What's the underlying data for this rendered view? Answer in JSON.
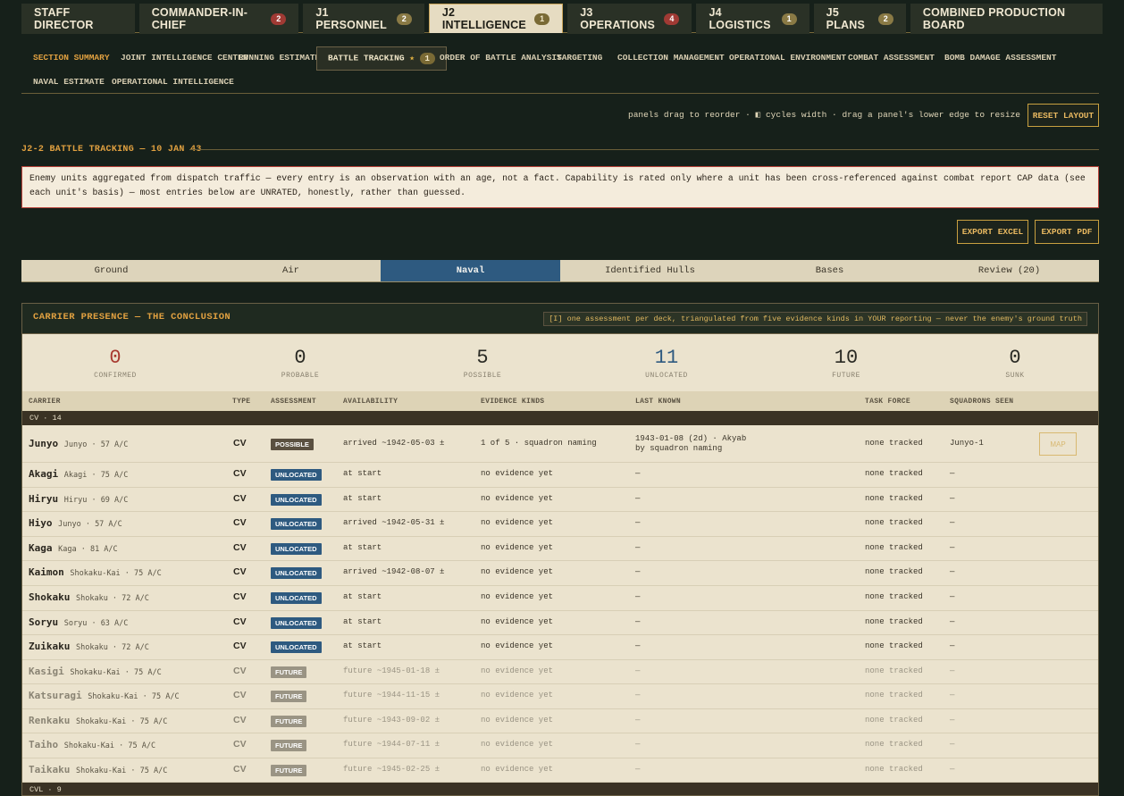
{
  "top_tabs": [
    {
      "label": "STAFF DIRECTOR",
      "badge": ""
    },
    {
      "label": "COMMANDER-IN-CHIEF",
      "badge": "2",
      "badge_style": "red"
    },
    {
      "label": "J1 PERSONNEL",
      "badge": "2",
      "badge_style": "olive"
    },
    {
      "label": "J2 INTELLIGENCE",
      "badge": "1",
      "badge_style": "gold",
      "active": true
    },
    {
      "label": "J3 OPERATIONS",
      "badge": "4",
      "badge_style": "red"
    },
    {
      "label": "J4 LOGISTICS",
      "badge": "1",
      "badge_style": "olive"
    },
    {
      "label": "J5 PLANS",
      "badge": "2",
      "badge_style": "olive"
    },
    {
      "label": "COMBINED PRODUCTION BOARD",
      "badge": ""
    }
  ],
  "sub_tabs": {
    "section_summary": "SECTION SUMMARY",
    "joint_intelligence_center": "JOINT INTELLIGENCE CENTER",
    "running_estimate": "RUNNING ESTIMATE",
    "battle_tracking": "BATTLE TRACKING",
    "battle_tracking_star": "★",
    "battle_tracking_badge": "1",
    "order_of_battle": "ORDER OF BATTLE ANALYSIS",
    "targeting": "TARGETING",
    "collection": "COLLECTION MANAGEMENT",
    "op_env": "OPERATIONAL ENVIRONMENT",
    "combat": "COMBAT ASSESSMENT",
    "bda": "BOMB DAMAGE ASSESSMENT",
    "naval_estimate": "NAVAL ESTIMATE",
    "op_intel": "OPERATIONAL INTELLIGENCE"
  },
  "layout_hint": "panels drag to reorder · ◧ cycles width · drag a panel's lower edge to resize",
  "reset_layout": "RESET LAYOUT",
  "section_title": "J2-2 BATTLE TRACKING — 10 JAN 43",
  "notice": "Enemy units aggregated from dispatch traffic — every entry is an observation with an age, not a fact. Capability is rated only where a unit has been cross-referenced against combat report CAP data (see each unit's basis) — most entries below are UNRATED, honestly, rather than guessed.",
  "export_excel": "EXPORT EXCEL",
  "export_pdf": "EXPORT PDF",
  "filter_tabs": {
    "ground": "Ground",
    "air": "Air",
    "naval": "Naval",
    "hulls": "Identified Hulls",
    "bases": "Bases",
    "review": "Review (20)"
  },
  "panel": {
    "title": "CARRIER PRESENCE — THE CONCLUSION",
    "note": "[I] one assessment per deck, triangulated from five evidence kinds in YOUR reporting — never the enemy's ground truth"
  },
  "stats": {
    "confirmed": {
      "value": "0",
      "label": "CONFIRMED",
      "color": "#a83a30"
    },
    "probable": {
      "value": "0",
      "label": "PROBABLE",
      "color": "#2a2a24"
    },
    "possible": {
      "value": "5",
      "label": "POSSIBLE",
      "color": "#2a2a24"
    },
    "unlocated": {
      "value": "11",
      "label": "UNLOCATED",
      "color": "#2e5a80"
    },
    "future": {
      "value": "10",
      "label": "FUTURE",
      "color": "#2a2a24"
    },
    "sunk": {
      "value": "0",
      "label": "SUNK",
      "color": "#2a2a24"
    }
  },
  "columns": {
    "carrier": "CARRIER",
    "type": "TYPE",
    "assessment": "ASSESSMENT",
    "availability": "AVAILABILITY",
    "evidence": "EVIDENCE KINDS",
    "last_known": "LAST KNOWN",
    "task_force": "TASK FORCE",
    "squadrons": "SQUADRONS SEEN"
  },
  "groups": {
    "cv": "CV · 14",
    "cvl": "CVL · 9"
  },
  "map_label": "MAP",
  "carriers": [
    {
      "name": "Junyo",
      "sub": "Junyo · 57 A/C",
      "type": "CV",
      "assessment": "POSSIBLE",
      "chip": "possible",
      "availability": "arrived ~1942-05-03 ±",
      "evidence": "1 of 5 · squadron naming",
      "last_known_1": "1943-01-08 (2d) · Akyab",
      "last_known_2": "by squadron naming",
      "task_force": "none tracked",
      "squadrons": "Junyo-1"
    },
    {
      "name": "Akagi",
      "sub": "Akagi · 75 A/C",
      "type": "CV",
      "assessment": "UNLOCATED",
      "chip": "unlocated",
      "availability": "at start",
      "evidence": "no evidence yet",
      "last_known_1": "—",
      "task_force": "none tracked",
      "squadrons": "—"
    },
    {
      "name": "Hiryu",
      "sub": "Hiryu · 69 A/C",
      "type": "CV",
      "assessment": "UNLOCATED",
      "chip": "unlocated",
      "availability": "at start",
      "evidence": "no evidence yet",
      "last_known_1": "—",
      "task_force": "none tracked",
      "squadrons": "—"
    },
    {
      "name": "Hiyo",
      "sub": "Junyo · 57 A/C",
      "type": "CV",
      "assessment": "UNLOCATED",
      "chip": "unlocated",
      "availability": "arrived ~1942-05-31 ±",
      "evidence": "no evidence yet",
      "last_known_1": "—",
      "task_force": "none tracked",
      "squadrons": "—"
    },
    {
      "name": "Kaga",
      "sub": "Kaga · 81 A/C",
      "type": "CV",
      "assessment": "UNLOCATED",
      "chip": "unlocated",
      "availability": "at start",
      "evidence": "no evidence yet",
      "last_known_1": "—",
      "task_force": "none tracked",
      "squadrons": "—"
    },
    {
      "name": "Kaimon",
      "sub": "Shokaku-Kai · 75 A/C",
      "type": "CV",
      "assessment": "UNLOCATED",
      "chip": "unlocated",
      "availability": "arrived ~1942-08-07 ±",
      "evidence": "no evidence yet",
      "last_known_1": "—",
      "task_force": "none tracked",
      "squadrons": "—"
    },
    {
      "name": "Shokaku",
      "sub": "Shokaku · 72 A/C",
      "type": "CV",
      "assessment": "UNLOCATED",
      "chip": "unlocated",
      "availability": "at start",
      "evidence": "no evidence yet",
      "last_known_1": "—",
      "task_force": "none tracked",
      "squadrons": "—"
    },
    {
      "name": "Soryu",
      "sub": "Soryu · 63 A/C",
      "type": "CV",
      "assessment": "UNLOCATED",
      "chip": "unlocated",
      "availability": "at start",
      "evidence": "no evidence yet",
      "last_known_1": "—",
      "task_force": "none tracked",
      "squadrons": "—"
    },
    {
      "name": "Zuikaku",
      "sub": "Shokaku · 72 A/C",
      "type": "CV",
      "assessment": "UNLOCATED",
      "chip": "unlocated",
      "availability": "at start",
      "evidence": "no evidence yet",
      "last_known_1": "—",
      "task_force": "none tracked",
      "squadrons": "—"
    },
    {
      "name": "Kasigi",
      "sub": "Shokaku-Kai · 75 A/C",
      "type": "CV",
      "assessment": "FUTURE",
      "chip": "future",
      "availability": "future ~1945-01-18 ±",
      "evidence": "no evidence yet",
      "last_known_1": "—",
      "task_force": "none tracked",
      "squadrons": "—"
    },
    {
      "name": "Katsuragi",
      "sub": "Shokaku-Kai · 75 A/C",
      "type": "CV",
      "assessment": "FUTURE",
      "chip": "future",
      "availability": "future ~1944-11-15 ±",
      "evidence": "no evidence yet",
      "last_known_1": "—",
      "task_force": "none tracked",
      "squadrons": "—"
    },
    {
      "name": "Renkaku",
      "sub": "Shokaku-Kai · 75 A/C",
      "type": "CV",
      "assessment": "FUTURE",
      "chip": "future",
      "availability": "future ~1943-09-02 ±",
      "evidence": "no evidence yet",
      "last_known_1": "—",
      "task_force": "none tracked",
      "squadrons": "—"
    },
    {
      "name": "Taiho",
      "sub": "Shokaku-Kai · 75 A/C",
      "type": "CV",
      "assessment": "FUTURE",
      "chip": "future",
      "availability": "future ~1944-07-11 ±",
      "evidence": "no evidence yet",
      "last_known_1": "—",
      "task_force": "none tracked",
      "squadrons": "—"
    },
    {
      "name": "Taikaku",
      "sub": "Shokaku-Kai · 75 A/C",
      "type": "CV",
      "assessment": "FUTURE",
      "chip": "future",
      "availability": "future ~1945-02-25 ±",
      "evidence": "no evidence yet",
      "last_known_1": "—",
      "task_force": "none tracked",
      "squadrons": "—"
    }
  ]
}
